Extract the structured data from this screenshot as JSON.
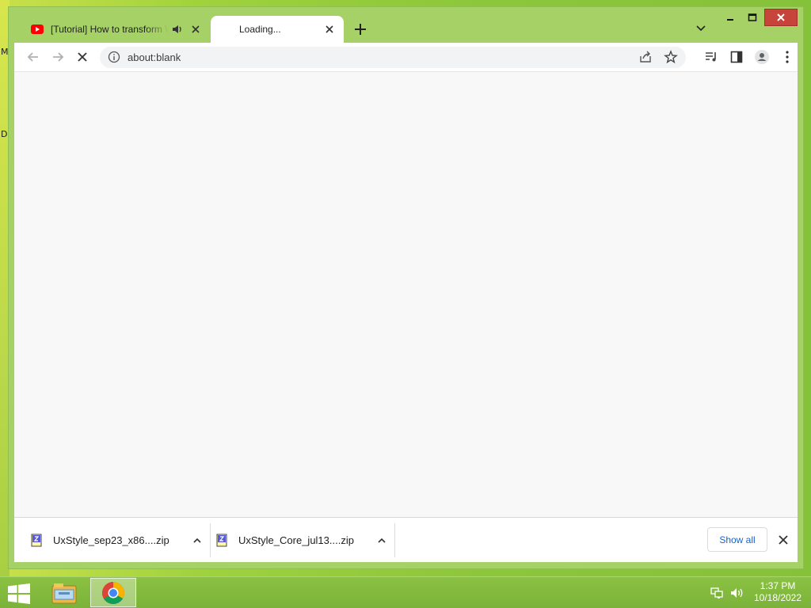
{
  "browser": {
    "tabs": [
      {
        "title": "[Tutorial] How to transform W",
        "state": "inactive",
        "favicon": "youtube-icon",
        "audio": true
      },
      {
        "title": "Loading...",
        "state": "active",
        "favicon": "loading-spinner-icon"
      }
    ],
    "address": {
      "url": "about:blank"
    },
    "colors": {
      "frame": "#a6d166",
      "close_button": "#c7443b",
      "link_blue": "#1a62c9"
    }
  },
  "downloads": {
    "items": [
      {
        "filename": "UxStyle_sep23_x86....zip",
        "icon": "zip-file-icon"
      },
      {
        "filename": "UxStyle_Core_jul13....zip",
        "icon": "zip-file-icon"
      }
    ],
    "show_all_label": "Show all"
  },
  "taskbar": {
    "clock": {
      "time": "1:37 PM",
      "date": "10/18/2022"
    },
    "apps": [
      "file-explorer-icon",
      "chrome-icon"
    ]
  },
  "desktop": {
    "edge_glyphs": [
      "M",
      "D"
    ]
  }
}
